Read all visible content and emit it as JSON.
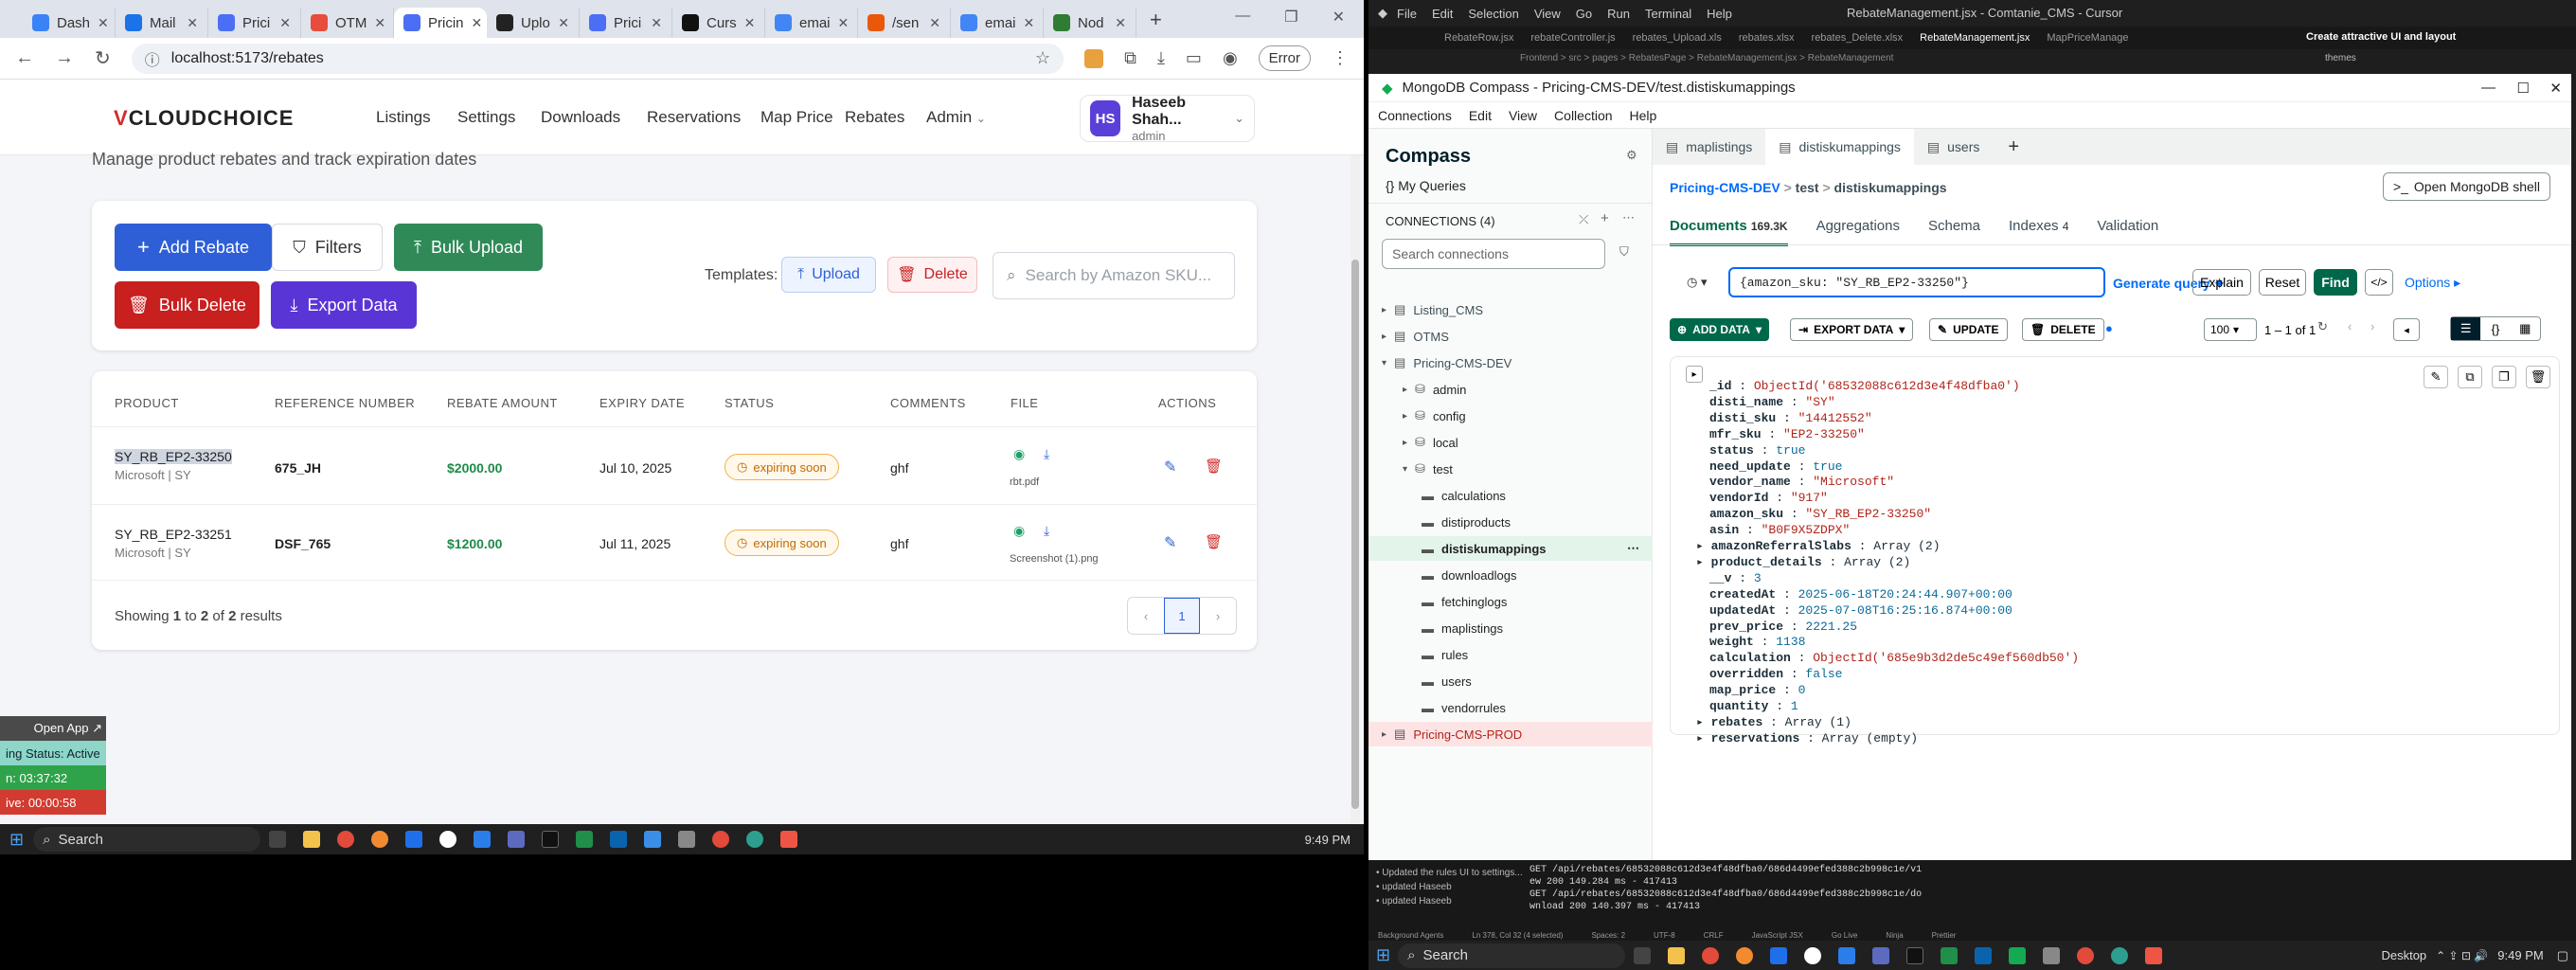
{
  "chrome": {
    "tabs": [
      {
        "label": "Dash",
        "color": "#3b82f6"
      },
      {
        "label": "Mail",
        "color": "#1a73e8"
      },
      {
        "label": "Prici",
        "color": "#4c6ef5"
      },
      {
        "label": "OTM",
        "color": "#e74c3c"
      },
      {
        "label": "Pricin",
        "color": "#4c6ef5"
      },
      {
        "label": "Uplo",
        "color": "#222"
      },
      {
        "label": "Prici",
        "color": "#4c6ef5"
      },
      {
        "label": "Curs",
        "color": "#111"
      },
      {
        "label": "emai",
        "color": "#4285f4"
      },
      {
        "label": "/sen",
        "color": "#ea580c"
      },
      {
        "label": "emai",
        "color": "#4285f4"
      },
      {
        "label": "Nod",
        "color": "#2e7d32"
      }
    ],
    "url": "localhost:5173/rebates",
    "error_label": "Error"
  },
  "app": {
    "logo_main": "CLOUDCHOICE",
    "nav": [
      "Listings",
      "Settings",
      "Downloads",
      "Reservations",
      "Map Price",
      "Rebates",
      "Admin"
    ],
    "user_name": "Haseeb Shah...",
    "user_role": "admin",
    "user_initials": "HS",
    "subtitle": "Manage product rebates and track expiration dates",
    "buttons": {
      "add": "Add Rebate",
      "filters": "Filters",
      "bulk_upload": "Bulk Upload",
      "bulk_delete": "Bulk Delete",
      "export": "Export Data"
    },
    "templates_label": "Templates:",
    "template_upload": "Upload",
    "template_delete": "Delete",
    "search_placeholder": "Search by Amazon SKU...",
    "table_headers": [
      "PRODUCT",
      "REFERENCE NUMBER",
      "REBATE AMOUNT",
      "EXPIRY DATE",
      "STATUS",
      "COMMENTS",
      "FILE",
      "ACTIONS"
    ],
    "rows": [
      {
        "sku": "SY_RB_EP2-33250",
        "sub": "Microsoft | SY",
        "ref": "675_JH",
        "amount": "$2000.00",
        "expiry": "Jul 10, 2025",
        "status": "expiring soon",
        "comments": "ghf",
        "file": "rbt.pdf"
      },
      {
        "sku": "SY_RB_EP2-33251",
        "sub": "Microsoft | SY",
        "ref": "DSF_765",
        "amount": "$1200.00",
        "expiry": "Jul 11, 2025",
        "status": "expiring soon",
        "comments": "ghf",
        "file": "Screenshot (1).png"
      }
    ],
    "showing_pre": "Showing ",
    "showing_from": "1",
    "showing_mid1": " to ",
    "showing_to": "2",
    "showing_mid2": " of ",
    "showing_total": "2",
    "showing_post": " results",
    "page": "1"
  },
  "floating_app": {
    "open": "Open App ↗",
    "status": "ing Status: Active",
    "t1": "n: 03:37:32",
    "t2": "ive: 00:00:58"
  },
  "taskbar_left": {
    "search": "Search",
    "time": "9:49 PM"
  },
  "cursor": {
    "menu": [
      "File",
      "Edit",
      "Selection",
      "View",
      "Go",
      "Run",
      "Terminal",
      "Help"
    ],
    "title": "RebateManagement.jsx - Comtanie_CMS - Cursor",
    "editor_tabs": [
      "RebateRow.jsx",
      "rebateController.js",
      "rebates_Upload.xls",
      "rebates.xlsx",
      "rebates_Delete.xlsx",
      "RebateManagement.jsx",
      "MapPriceManage"
    ],
    "breadcrumb": "Frontend > src > pages > RebatesPage > RebateManagement.jsx > RebateManagement",
    "right_panel": "Create attractive UI and layout",
    "right_sub": "themes",
    "terminal": [
      "• Updated the rules UI to settings...",
      "• updated Haseeb",
      "• updated Haseeb"
    ],
    "log": [
      "GET /api/rebates/68532088c612d3e4f48dfba0/686d4499efed388c2b998c1e/v1",
      "ew 200 149.284 ms - 417413",
      "GET /api/rebates/68532088c612d3e4f48dfba0/686d4499efed388c2b998c1e/do",
      "wnload 200 140.397 ms - 417413"
    ],
    "status_items": [
      "Background Agents",
      "Ln 378, Col 32 (4 selected)",
      "Spaces: 2",
      "UTF-8",
      "CRLF",
      "JavaScript JSX",
      "Go Live",
      "Ninja",
      "Prettier"
    ]
  },
  "compass": {
    "title": "MongoDB Compass - Pricing-CMS-DEV/test.distiskumappings",
    "menu": [
      "Connections",
      "Edit",
      "View",
      "Collection",
      "Help"
    ],
    "brand": "Compass",
    "my_queries": "My Queries",
    "connections_label": "CONNECTIONS (4)",
    "search_connections": "Search connections",
    "tree": [
      {
        "label": "Listing_CMS",
        "level": 0,
        "type": "conn"
      },
      {
        "label": "OTMS",
        "level": 0,
        "type": "conn"
      },
      {
        "label": "Pricing-CMS-DEV",
        "level": 0,
        "type": "conn",
        "open": true
      },
      {
        "label": "admin",
        "level": 1,
        "type": "db"
      },
      {
        "label": "config",
        "level": 1,
        "type": "db"
      },
      {
        "label": "local",
        "level": 1,
        "type": "db"
      },
      {
        "label": "test",
        "level": 1,
        "type": "db",
        "open": true
      },
      {
        "label": "calculations",
        "level": 2,
        "type": "coll"
      },
      {
        "label": "distiproducts",
        "level": 2,
        "type": "coll"
      },
      {
        "label": "distiskumappings",
        "level": 2,
        "type": "coll",
        "active": true
      },
      {
        "label": "downloadlogs",
        "level": 2,
        "type": "coll"
      },
      {
        "label": "fetchinglogs",
        "level": 2,
        "type": "coll"
      },
      {
        "label": "maplistings",
        "level": 2,
        "type": "coll"
      },
      {
        "label": "rules",
        "level": 2,
        "type": "coll"
      },
      {
        "label": "users",
        "level": 2,
        "type": "coll"
      },
      {
        "label": "vendorrules",
        "level": 2,
        "type": "coll"
      },
      {
        "label": "Pricing-CMS-PROD",
        "level": 0,
        "type": "conn",
        "prod": true
      }
    ],
    "coll_tabs": [
      "maplistings",
      "distiskumappings",
      "users"
    ],
    "bc_db": "Pricing-CMS-DEV",
    "bc_coll1": "test",
    "bc_coll2": "distiskumappings",
    "open_shell": "Open MongoDB shell",
    "sub_tabs": [
      "Documents",
      "Aggregations",
      "Schema",
      "Indexes",
      "Validation"
    ],
    "doc_count": "169.3K",
    "index_count": "4",
    "query": "{amazon_sku: \"SY_RB_EP2-33250\"}",
    "generate_query": "Generate query",
    "explain": "Explain",
    "reset": "Reset",
    "find": "Find",
    "options": "Options",
    "add_data": "ADD DATA",
    "export_data": "EXPORT DATA",
    "update": "UPDATE",
    "delete": "DELETE",
    "page_size": "100",
    "range": "1 – 1 of 1",
    "doc_lines": [
      {
        "k": "_id",
        "v": "ObjectId('68532088c612d3e4f48dfba0')",
        "t": "s"
      },
      {
        "k": "disti_name",
        "v": "\"SY\"",
        "t": "s"
      },
      {
        "k": "disti_sku",
        "v": "\"14412552\"",
        "t": "s"
      },
      {
        "k": "mfr_sku",
        "v": "\"EP2-33250\"",
        "t": "s"
      },
      {
        "k": "status",
        "v": "true",
        "t": "n"
      },
      {
        "k": "need_update",
        "v": "true",
        "t": "n"
      },
      {
        "k": "vendor_name",
        "v": "\"Microsoft\"",
        "t": "s"
      },
      {
        "k": "vendorId",
        "v": "\"917\"",
        "t": "s"
      },
      {
        "k": "amazon_sku",
        "v": "\"SY_RB_EP2-33250\"",
        "t": "s"
      },
      {
        "k": "asin",
        "v": "\"B0F9X5ZDPX\"",
        "t": "s"
      },
      {
        "k": "amazonReferralSlabs",
        "v": "Array (2)",
        "t": "k",
        "arrow": true
      },
      {
        "k": "product_details",
        "v": "Array (2)",
        "t": "k",
        "arrow": true
      },
      {
        "k": "__v",
        "v": "3",
        "t": "n"
      },
      {
        "k": "createdAt",
        "v": "2025-06-18T20:24:44.907+00:00",
        "t": "n"
      },
      {
        "k": "updatedAt",
        "v": "2025-07-08T16:25:16.874+00:00",
        "t": "n"
      },
      {
        "k": "prev_price",
        "v": "2221.25",
        "t": "n"
      },
      {
        "k": "weight",
        "v": "1138",
        "t": "n"
      },
      {
        "k": "calculation",
        "v": "ObjectId('685e9b3d2de5c49ef560db50')",
        "t": "s"
      },
      {
        "k": "overridden",
        "v": "false",
        "t": "n"
      },
      {
        "k": "map_price",
        "v": "0",
        "t": "n"
      },
      {
        "k": "quantity",
        "v": "1",
        "t": "n"
      },
      {
        "k": "rebates",
        "v": "Array (1)",
        "t": "k",
        "arrow": true
      },
      {
        "k": "reservations",
        "v": "Array (empty)",
        "t": "k",
        "arrow": true
      }
    ]
  },
  "taskbar_right": {
    "search": "Search",
    "time": "9:49 PM",
    "layout": "Desktop"
  }
}
